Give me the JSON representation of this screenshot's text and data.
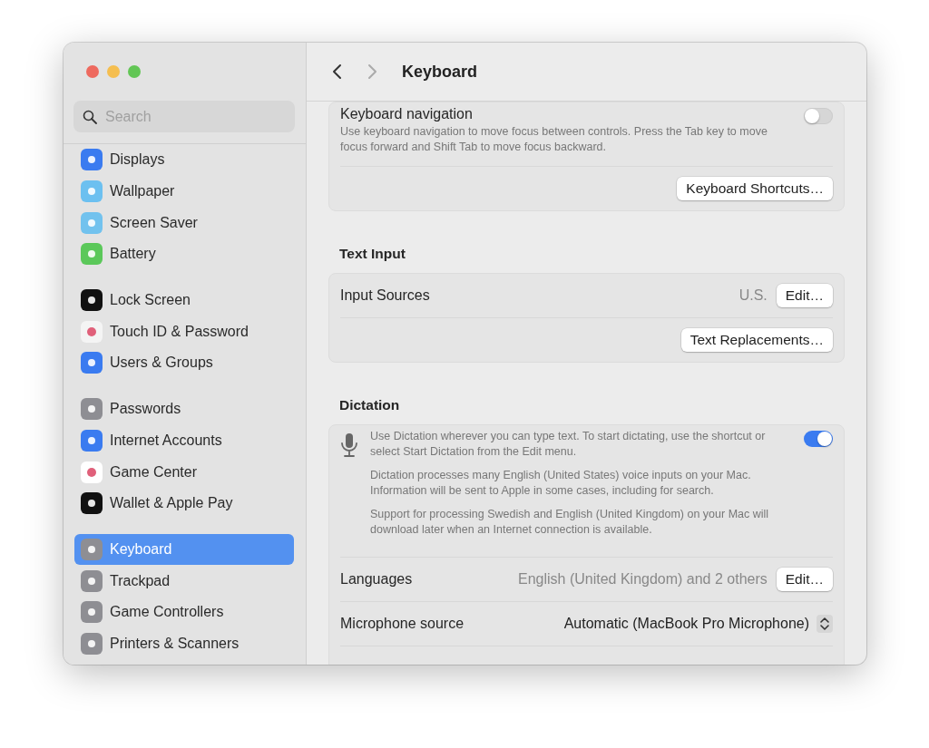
{
  "window": {
    "title": "Keyboard"
  },
  "search": {
    "placeholder": "Search"
  },
  "sidebar": {
    "groups": [
      {
        "items": [
          {
            "label": "Displays",
            "selected": false
          },
          {
            "label": "Wallpaper",
            "selected": false
          },
          {
            "label": "Screen Saver",
            "selected": false
          },
          {
            "label": "Battery",
            "selected": false
          }
        ]
      },
      {
        "items": [
          {
            "label": "Lock Screen",
            "selected": false
          },
          {
            "label": "Touch ID & Password",
            "selected": false
          },
          {
            "label": "Users & Groups",
            "selected": false
          }
        ]
      },
      {
        "items": [
          {
            "label": "Passwords",
            "selected": false
          },
          {
            "label": "Internet Accounts",
            "selected": false
          },
          {
            "label": "Game Center",
            "selected": false
          },
          {
            "label": "Wallet & Apple Pay",
            "selected": false
          }
        ]
      },
      {
        "items": [
          {
            "label": "Keyboard",
            "selected": true
          },
          {
            "label": "Trackpad",
            "selected": false
          },
          {
            "label": "Game Controllers",
            "selected": false
          },
          {
            "label": "Printers & Scanners",
            "selected": false
          }
        ]
      }
    ]
  },
  "keyboard_navigation": {
    "label": "Keyboard navigation",
    "description": "Use keyboard navigation to move focus between controls. Press the Tab key to move focus forward and Shift Tab to move focus backward.",
    "on": false,
    "button": "Keyboard Shortcuts…"
  },
  "text_input": {
    "heading": "Text Input",
    "input_sources": {
      "label": "Input Sources",
      "value": "U.S.",
      "button": "Edit…"
    },
    "button": "Text Replacements…"
  },
  "dictation": {
    "heading": "Dictation",
    "on": true,
    "paragraphs": [
      "Use Dictation wherever you can type text. To start dictating, use the shortcut or select Start Dictation from the Edit menu.",
      "Dictation processes many English (United States) voice inputs on your Mac. Information will be sent to Apple in some cases, including for search.",
      "Support for processing Swedish and English (United Kingdom) on your Mac will download later when an Internet connection is available."
    ],
    "languages": {
      "label": "Languages",
      "value": "English (United Kingdom) and 2 others",
      "button": "Edit…"
    },
    "microphone_source": {
      "label": "Microphone source",
      "value": "Automatic (MacBook Pro Microphone)"
    }
  }
}
